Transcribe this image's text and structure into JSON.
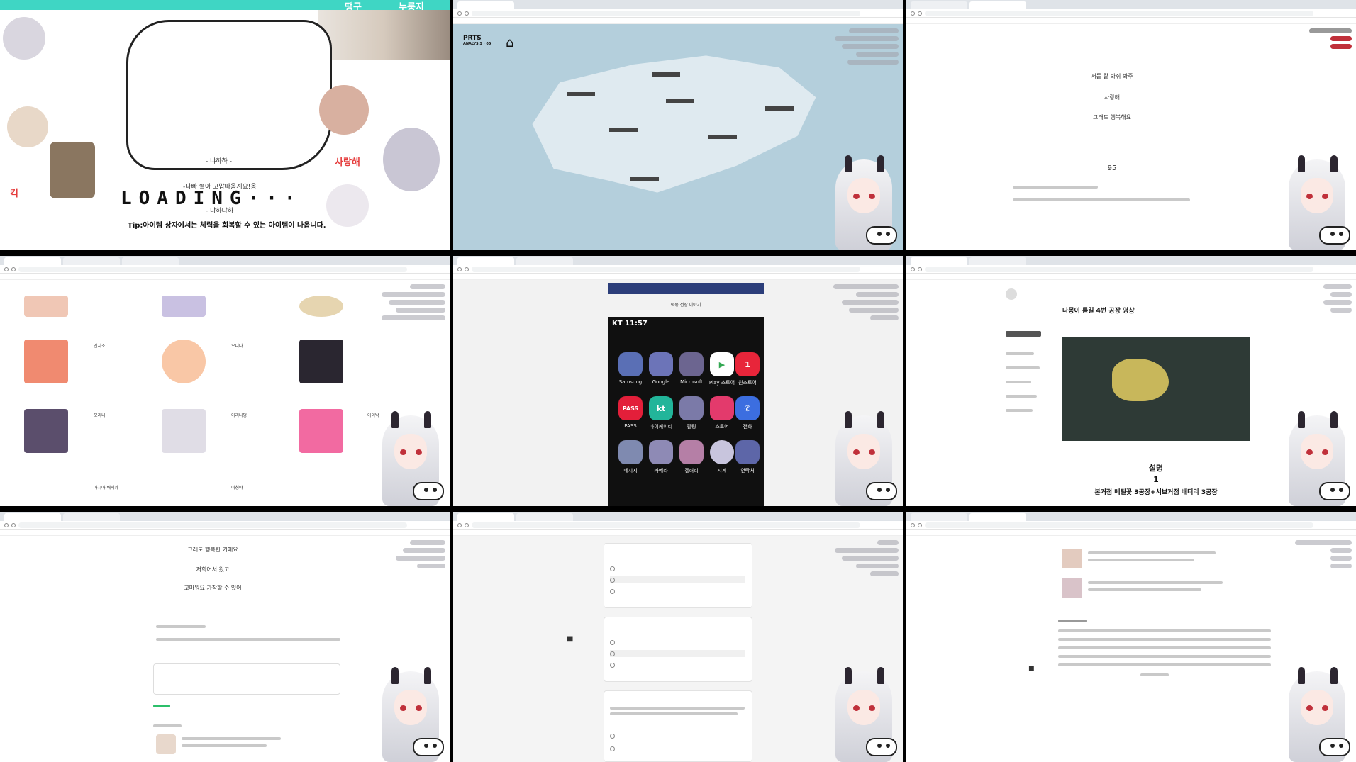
{
  "cell1": {
    "topbar_left": "땡구",
    "topbar_right": "누룽지",
    "loading": "LOADING···",
    "tip": "Tip:아이템 상자에서는 체력을 회복할 수 있는 아이템이 나옵니다.",
    "caption_a": "- 냐하하 -",
    "caption_b": "-나빠 혈아 고맙따옹계요!옹",
    "caption_c": "- 냐하냐하",
    "red_a": "사랑해",
    "red_b": "킥"
  },
  "cell2": {
    "logo_line1": "PRTS",
    "logo_line2": "ANALYSIS · 05",
    "house_icon": "home-icon"
  },
  "cell3": {
    "line1": "저를 잘 봐줘 봐주",
    "line2": "사랑해",
    "line3": "그래도 행복해요",
    "number": "95"
  },
  "cell4": {
    "labels": [
      "엔치조",
      "오디다",
      "모리니",
      "아리나멍",
      "아이박",
      "아시아 배지카",
      "이청야"
    ]
  },
  "cell5": {
    "header": "떡볶 전장 이야기",
    "time": "KT 11:57",
    "apps": [
      "Samsung",
      "Google",
      "Microsoft",
      "Play 스토어",
      "원스토어",
      "PASS",
      "마이케이티",
      "필링",
      "스토어",
      "전화",
      "메시지",
      "카메라",
      "갤러리",
      "시계",
      "연락처"
    ]
  },
  "cell6": {
    "title": "나몽이 롬길 4번 공장 영상",
    "heading": "설명",
    "number": "1",
    "desc": "본거점 메틸꽃 3공장+서브거점 배터리 3공장"
  },
  "cell7": {
    "line1": "그래도 행복한 거에요",
    "line2": "저희어서 왔고",
    "line3": "고마워요 가장할 수 있어"
  },
  "colors": {
    "teal": "#3fd6c4",
    "map_sea": "#a9c8d6",
    "red": "#e53b3b"
  }
}
